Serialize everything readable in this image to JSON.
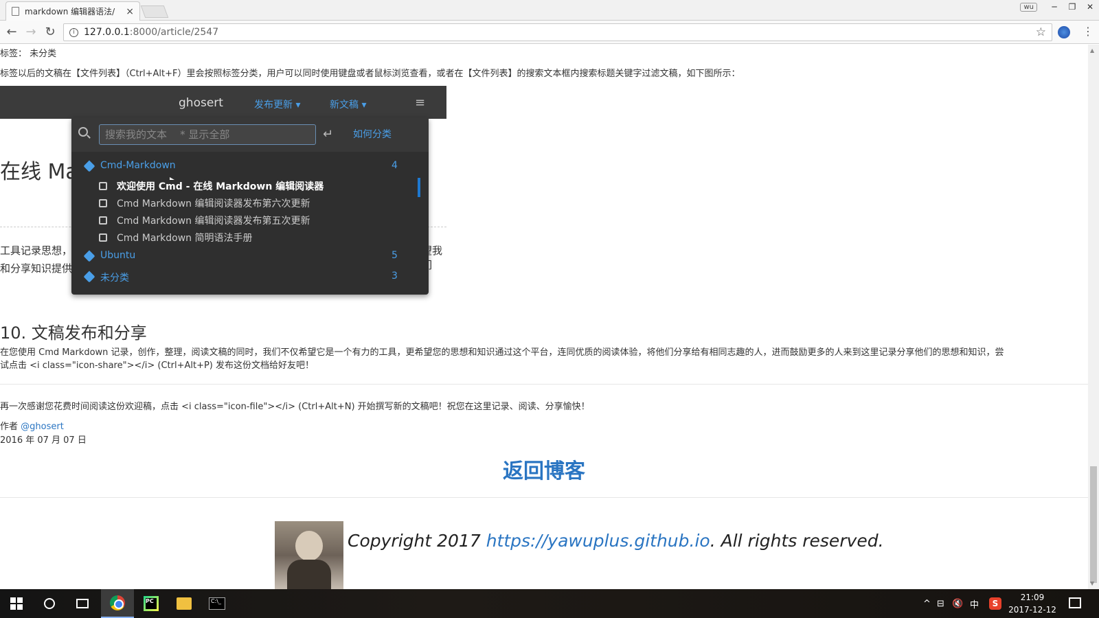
{
  "browser": {
    "tab_title": "markdown 编辑器语法/",
    "tab_close": "×",
    "user_badge": "wu",
    "window_controls": [
      "─",
      "❐",
      "✕"
    ],
    "url_host": "127.0.0.1",
    "url_path": ":8000/article/2547",
    "back": "←",
    "forward": "→",
    "reload": "↻",
    "star": "☆",
    "menu": "⋮"
  },
  "page": {
    "tag_line": "标签： 未分类",
    "intro_text": "标签以后的文稿在【文件列表】（Ctrl+Alt+F）里会按照标签分类，用户可以同时使用键盘或者鼠标浏览查看，或者在【文件列表】的搜索文本框内搜索标题关键字过滤文稿，如下图所示：",
    "screenshot": {
      "brand": "ghosert",
      "nav_publish": "发布更新 ▾",
      "nav_new": "新文稿 ▾",
      "hamburger": "≡",
      "bg_title": "在线 Ma",
      "bg_line1": "工具记录思想，",
      "bg_line2": "和分享知识提供",
      "bg_line3": "望我们",
      "search_placeholder": "搜索我的文本    * 显示全部",
      "enter_glyph": "↵",
      "howto_link": "如何分类",
      "tags": [
        {
          "name": "Cmd-Markdown",
          "count": "4"
        },
        {
          "name": "Ubuntu",
          "count": "5"
        },
        {
          "name": "未分类",
          "count": "3"
        }
      ],
      "docs": [
        "欢迎使用 Cmd - 在线 Markdown 编辑阅读器",
        "Cmd Markdown 编辑阅读器发布第六次更新",
        "Cmd Markdown 编辑阅读器发布第五次更新",
        "Cmd Markdown 简明语法手册"
      ]
    },
    "section_heading": "10. 文稿发布和分享",
    "share_para_1": "在您使用 Cmd Markdown 记录，创作，整理，阅读文稿的同时，我们不仅希望它是一个有力的工具，更希望您的思想和知识通过这个平台，连同优质的阅读体验，将他们分享给有相同志趣的人，进而鼓励更多的人来到这里记录分享他们的思想和知识，尝",
    "share_para_2": "试点击 <i class=\"icon-share\"></i> (Ctrl+Alt+P) 发布这份文档给好友吧！",
    "thanks_para": "再一次感谢您花费时间阅读这份欢迎稿，点击 <i class=\"icon-file\"></i> (Ctrl+Alt+N) 开始撰写新的文稿吧！祝您在这里记录、阅读、分享愉快！",
    "author_prefix": "作者",
    "author_link": "@ghosert",
    "date": "2016 年 07 月 07 日",
    "back_link": "返回博客",
    "copyright_prefix": "Copyright 2017 ",
    "copyright_link": "https://yawuplus.github.io",
    "copyright_suffix": ". All rights reserved."
  },
  "taskbar": {
    "tray_caret": "^",
    "tray_network": "⊟",
    "tray_volume": "🔇",
    "ime_lang": "中",
    "ime_s": "S",
    "time": "21:09",
    "date": "2017-12-12"
  }
}
